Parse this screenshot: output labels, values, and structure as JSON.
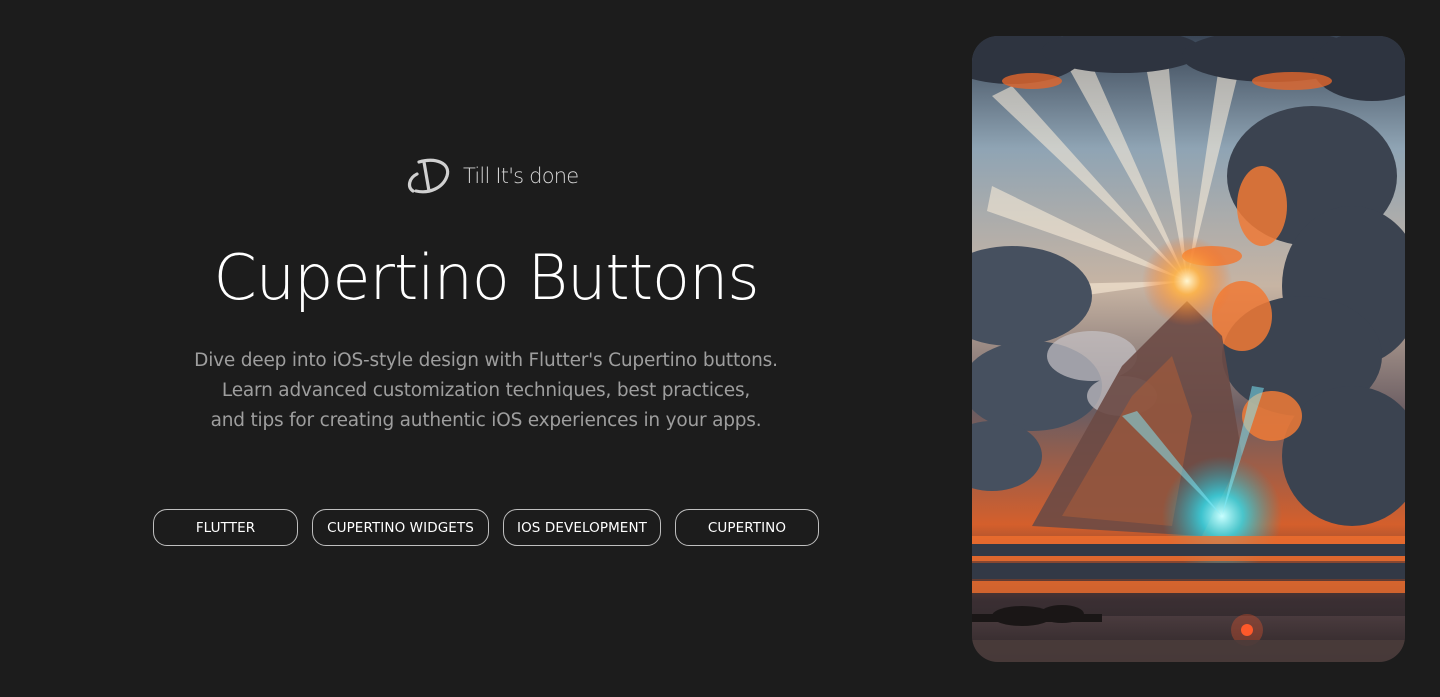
{
  "brand": {
    "name": "Till It's done"
  },
  "hero": {
    "title": "Cupertino Buttons",
    "description_lines": [
      "Dive deep into iOS-style design with Flutter's Cupertino buttons.",
      "Learn advanced customization techniques, best practices,",
      "and tips for creating authentic iOS experiences in your apps."
    ]
  },
  "tags": [
    {
      "label": "FLUTTER"
    },
    {
      "label": "CUPERTINO WIDGETS"
    },
    {
      "label": "IOS DEVELOPMENT"
    },
    {
      "label": "CUPERTINO"
    }
  ],
  "colors": {
    "background": "#1c1c1c",
    "title": "#ffffff",
    "description": "#9e9e9e",
    "tag_border": "#bfbfbf"
  },
  "image": {
    "subject": "sunset-clouds-artwork"
  }
}
